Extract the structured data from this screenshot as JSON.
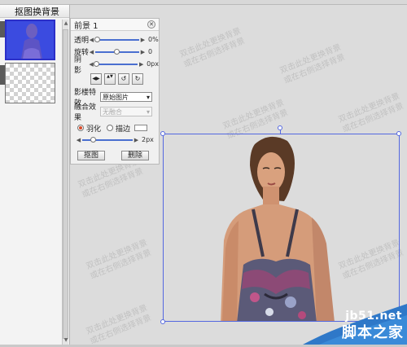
{
  "left_panel": {
    "title": "抠图换背景",
    "layers": [
      {
        "type": "photo",
        "selected": true
      },
      {
        "type": "transparent",
        "selected": false
      }
    ]
  },
  "properties_panel": {
    "title": "前景 1",
    "close_icon": "close-icon",
    "sliders": [
      {
        "label": "透明",
        "value_text": "0%",
        "level": 0.0
      },
      {
        "label": "旋转",
        "value_text": "0",
        "level": 0.5
      },
      {
        "label": "阴影",
        "value_text": "0px",
        "level": 0.0
      }
    ],
    "tool_buttons": [
      {
        "name": "flip-horizontal-icon",
        "glyph": "◀▶"
      },
      {
        "name": "flip-vertical-icon",
        "glyph": "▲▼"
      },
      {
        "name": "rotate-left-icon",
        "glyph": "↺"
      },
      {
        "name": "rotate-right-icon",
        "glyph": "↻"
      }
    ],
    "effect": {
      "label": "影楼特效",
      "value": "原始图片"
    },
    "blend": {
      "label": "融合效果",
      "value": "无融合"
    },
    "edge_options": [
      {
        "label": "羽化",
        "checked": true
      },
      {
        "label": "描边",
        "checked": false
      }
    ],
    "feather": {
      "value_text": "2px",
      "level": 0.2
    },
    "buttons": {
      "cutout": "抠图",
      "delete": "删除"
    }
  },
  "watermark": [
    "双击此处更换背景",
    "或在右侧选择背景"
  ],
  "corner_logo": {
    "site": "jb51.net",
    "name": "脚本之家"
  },
  "colors": {
    "selection": "#5468e0",
    "layer_selected": "#3b4be0",
    "slider_track": "#4a6fd0"
  }
}
